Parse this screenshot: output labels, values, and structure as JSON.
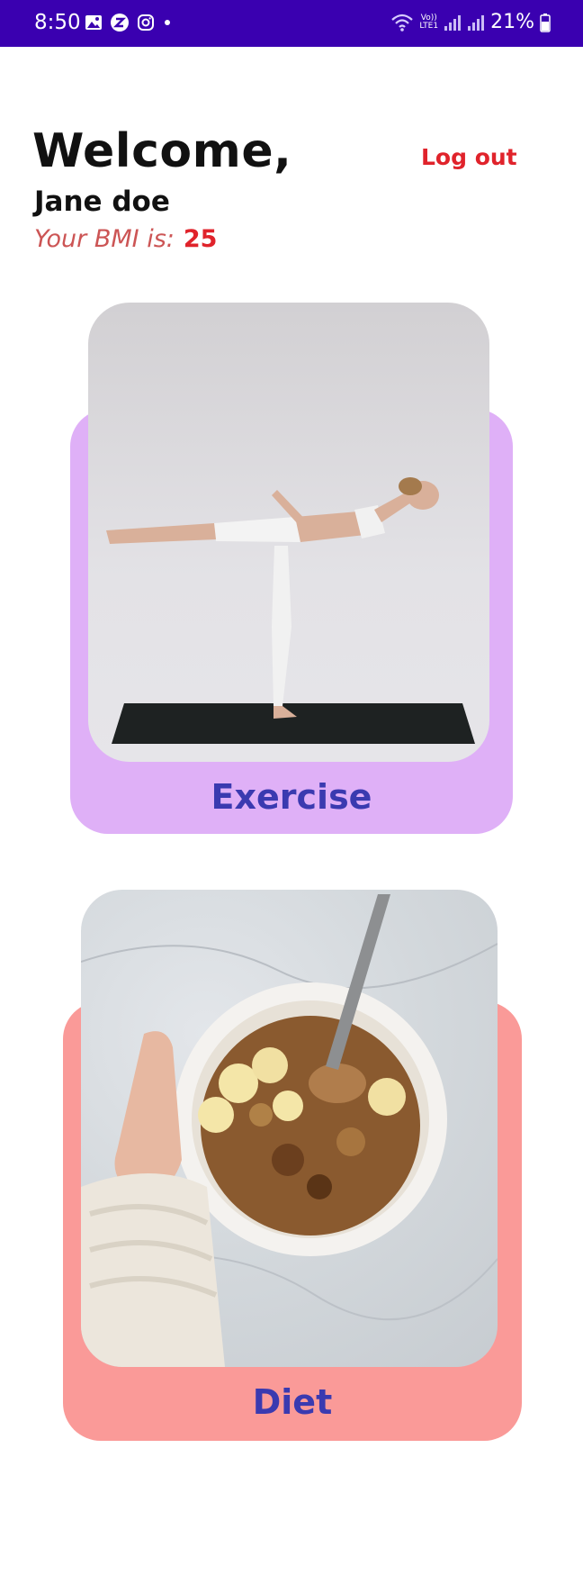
{
  "status_bar": {
    "time": "8:50",
    "lte_label": "LTE1",
    "volte_label": "Vo))",
    "battery": "21%",
    "background_color": "#3a00b0",
    "icons": [
      "gallery-icon",
      "z-app-icon",
      "instagram-icon",
      "dot-icon",
      "wifi-icon",
      "volte-icon",
      "signal-icon",
      "signal-icon",
      "battery-icon"
    ]
  },
  "header": {
    "welcome": "Welcome,",
    "user_name": "Jane doe",
    "bmi_label": "Your BMI is:",
    "bmi_value": "25",
    "logout_label": "Log out",
    "accent_color": "#e0232b"
  },
  "cards": {
    "exercise": {
      "label": "Exercise",
      "background_color": "#dfb0f7",
      "image": "yoga-pose-photo"
    },
    "diet": {
      "label": "Diet",
      "background_color": "#fa9a98",
      "image": "granola-bowl-photo"
    }
  }
}
